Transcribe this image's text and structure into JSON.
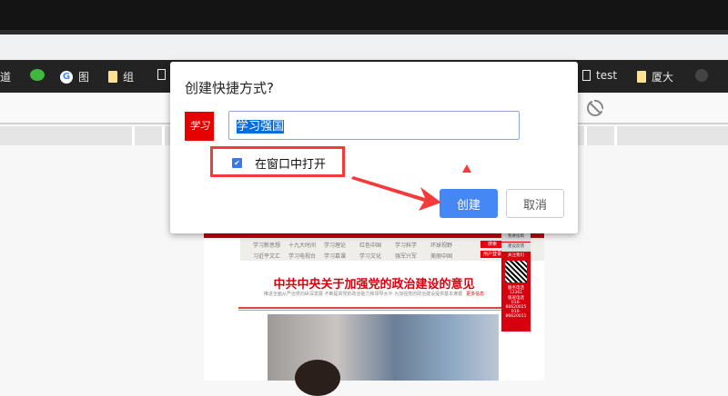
{
  "bookmarks": [
    {
      "label": "道",
      "icon": "none"
    },
    {
      "label": "",
      "icon": "wechat-icon"
    },
    {
      "label": "图",
      "icon": "google-icon"
    },
    {
      "label": "组",
      "icon": "folder-icon"
    },
    {
      "label": "",
      "icon": "page-icon"
    },
    {
      "label": "test",
      "icon": "page-icon"
    },
    {
      "label": "厦大",
      "icon": "folder-icon"
    }
  ],
  "dialog": {
    "title": "创建快捷方式?",
    "app_icon_text": "学习",
    "name_value": "学习强国",
    "checkbox_label": "在窗口中打开",
    "checkbox_checked": true,
    "create_label": "创建",
    "cancel_label": "取消",
    "accent": "#4487f5",
    "highlight": "#f43a3a"
  },
  "site": {
    "nav_links": [
      "学习新思想",
      "十九大时间",
      "学习理论",
      "红色中国",
      "学习科学",
      "环球视野",
      "习近平文汇",
      "学习电视台",
      "学习慕课",
      "学习文化",
      "强军兴军",
      "美丽中国"
    ],
    "search_label": "搜索",
    "login_label": "用户登录",
    "headline": "中共中央关于加强党的政治建设的意见",
    "subline": "推进全面从严治党向纵深发展 不断提高党的政治能力和领导水平 为加强党的政治建设提供基本遵循",
    "more": "更多信息",
    "side": [
      "我要投稿",
      "建议反馈",
      "关注我们",
      "服务电话",
      "12361",
      "值班电话",
      "010-86620025",
      "010-86620011"
    ]
  }
}
